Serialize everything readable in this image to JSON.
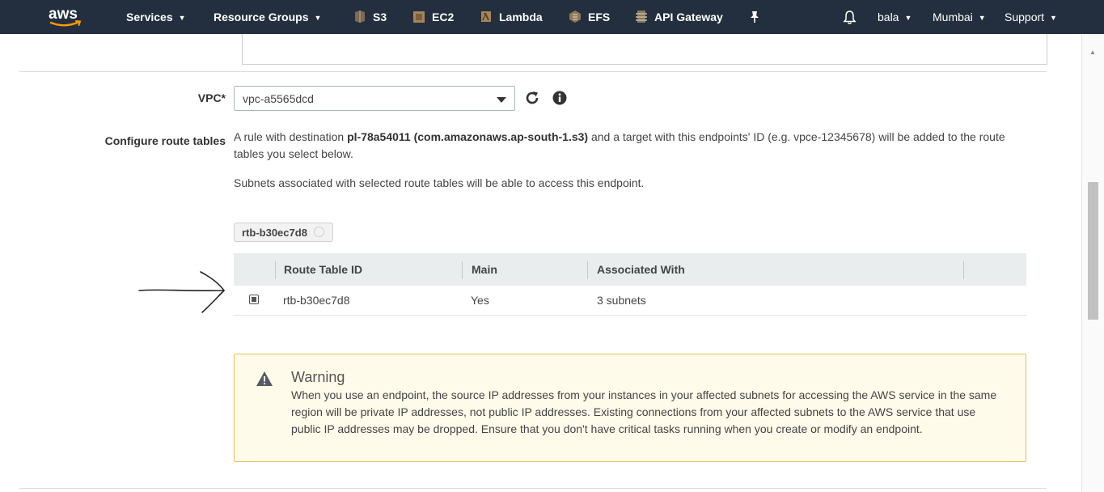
{
  "nav": {
    "services": "Services",
    "resource_groups": "Resource Groups",
    "shortcuts": [
      {
        "label": "S3",
        "icon": "s3-icon",
        "color": "#8c4fff"
      },
      {
        "label": "EC2",
        "icon": "ec2-icon",
        "color": "#e98d3a"
      },
      {
        "label": "Lambda",
        "icon": "lambda-icon",
        "color": "#e98d3a"
      },
      {
        "label": "EFS",
        "icon": "efs-icon",
        "color": "#e98d3a"
      },
      {
        "label": "API Gateway",
        "icon": "api-gateway-icon",
        "color": "#c7b89a"
      }
    ],
    "user": "bala",
    "region": "Mumbai",
    "support": "Support"
  },
  "vpc": {
    "label": "VPC*",
    "selected": "vpc-a5565dcd"
  },
  "route_tables": {
    "label": "Configure route tables",
    "desc_prefix": "A rule with destination ",
    "desc_prefix_list": "pl-78a54011 (com.amazonaws.ap-south-1.s3)",
    "desc_suffix": " and a target with this endpoints' ID (e.g. vpce-12345678) will be added to the route tables you select below.",
    "subnet_note": "Subnets associated with selected route tables will be able to access this endpoint.",
    "selected_chip": "rtb-b30ec7d8",
    "columns": [
      "Route Table ID",
      "Main",
      "Associated With"
    ],
    "rows": [
      {
        "id": "rtb-b30ec7d8",
        "main": "Yes",
        "associated": "3 subnets",
        "checked": true
      }
    ]
  },
  "warning": {
    "title": "Warning",
    "text": "When you use an endpoint, the source IP addresses from your instances in your affected subnets for accessing the AWS service in the same region will be private IP addresses, not public IP addresses. Existing connections from your affected subnets to the AWS service that use public IP addresses may be dropped. Ensure that you don't have critical tasks running when you create or modify an endpoint."
  },
  "colors": {
    "nav_bg": "#232f3e",
    "warning_bg": "#fffbea",
    "warning_border": "#e5bf5a",
    "table_header_bg": "#eaeded"
  }
}
